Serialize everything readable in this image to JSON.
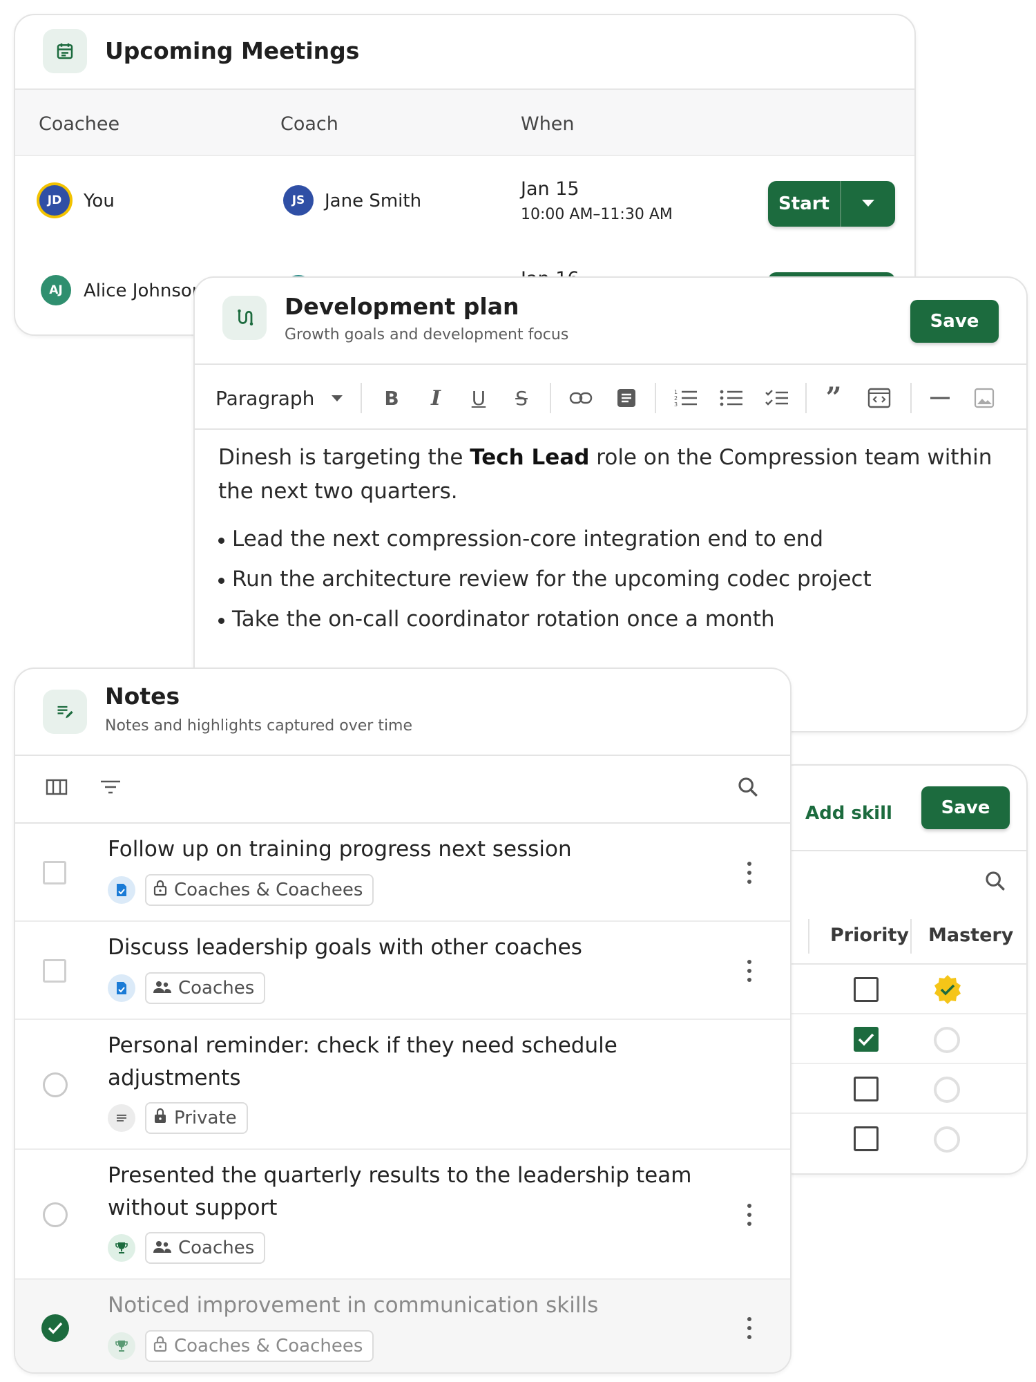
{
  "meetings": {
    "title": "Upcoming Meetings",
    "columns": [
      "Coachee",
      "Coach",
      "When"
    ],
    "rows": [
      {
        "coachee_initials": "JD",
        "coachee": "You",
        "coach_initials": "JS",
        "coach": "Jane Smith",
        "date": "Jan 15",
        "time": "10:00 AM–11:30 AM",
        "start_label": "Start"
      },
      {
        "coachee_initials": "AJ",
        "coachee": "Alice Johnson",
        "date": "Jan 16"
      }
    ]
  },
  "devplan": {
    "title": "Development plan",
    "subtitle": "Growth goals and development focus",
    "save_label": "Save",
    "toolbar": {
      "block_type": "Paragraph"
    },
    "content": {
      "intro_before": "Dinesh is targeting the ",
      "intro_bold": "Tech Lead",
      "intro_after": " role on the Compression team within the next two quarters.",
      "bullets": [
        "Lead the next compression-core integration end to end",
        "Run the architecture review for the upcoming codec project",
        "Take the on-call coordinator rotation once a month"
      ]
    }
  },
  "skills": {
    "add_label": "Add skill",
    "save_label": "Save",
    "columns": [
      "Priority",
      "Mastery"
    ],
    "rows": [
      {
        "priority": false,
        "mastery": true
      },
      {
        "priority": true,
        "mastery": false
      },
      {
        "priority": false,
        "mastery": false
      },
      {
        "priority": false,
        "mastery": false
      }
    ]
  },
  "notes": {
    "title": "Notes",
    "subtitle": "Notes and highlights captured over time",
    "items": [
      {
        "title": "Follow up on training progress next session",
        "visibility": "Coaches & Coachees"
      },
      {
        "title": "Discuss leadership goals with other coaches",
        "visibility": "Coaches"
      },
      {
        "title": "Personal reminder: check if they need schedule adjustments",
        "visibility": "Private"
      },
      {
        "title": "Presented the quarterly results to the leadership team without support",
        "visibility": "Coaches"
      },
      {
        "title": "Noticed improvement in communication skills",
        "visibility": "Coaches & Coachees"
      }
    ]
  },
  "colors": {
    "brand_green": "#1c6b3e",
    "mastery_yellow": "#f5c518",
    "info_blue": "#1a7bd6"
  }
}
